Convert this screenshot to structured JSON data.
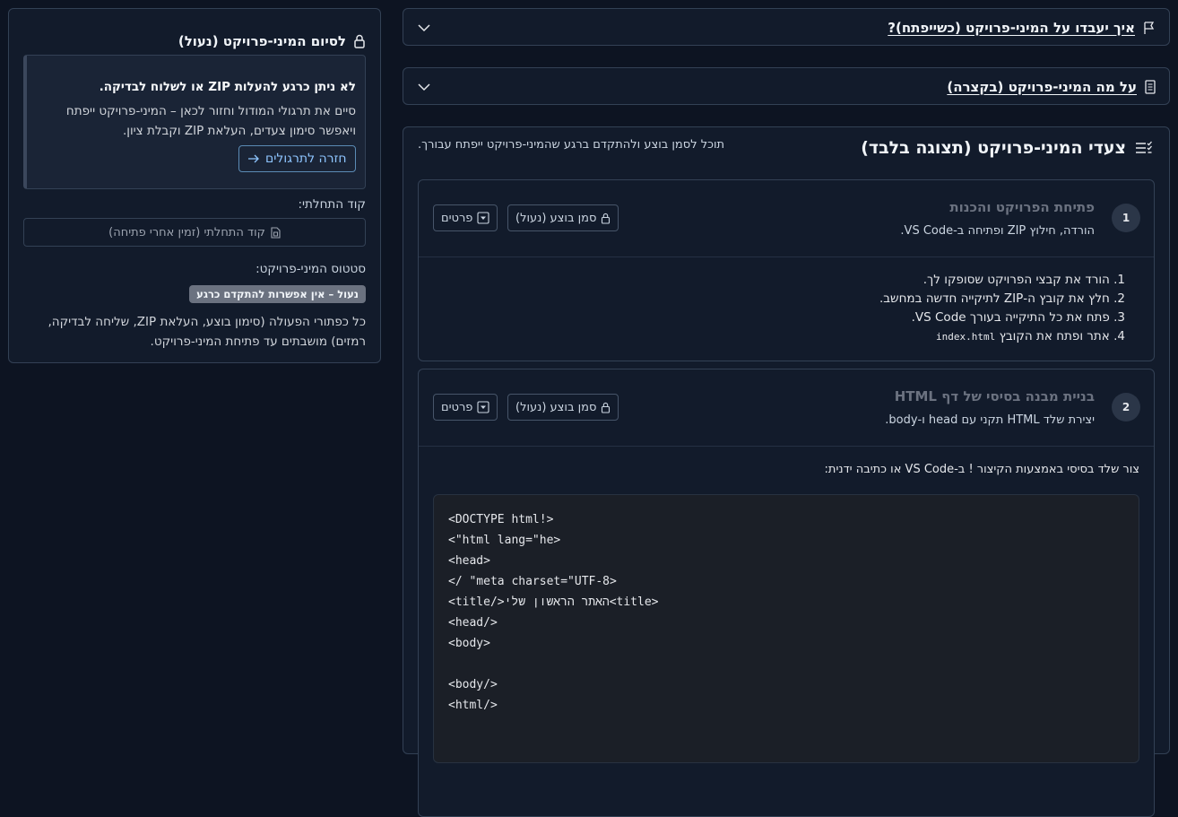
{
  "side": {
    "title": "לסיום המיני-פרויקט (נעול)",
    "warning_title": "לא ניתן כרגע להעלות ZIP או לשלוח לבדיקה.",
    "warning_body": "סיים את תרגולי המודול וחזור לכאן – המיני-פרויקט ייפתח ויאפשר סימון צעדים, העלאת ZIP וקבלת ציון.",
    "back_button": "חזרה לתרגולים",
    "code_label": "קוד התחלתי:",
    "code_button": "קוד התחלתי (זמין אחרי פתיחה)",
    "status_label": "סטטוס המיני-פרויקט:",
    "status_badge": "נעול – אין אפשרות להתקדם כרגע",
    "status_note": "כל כפתורי הפעולה (סימון בוצע, העלאת ZIP, שליחה לבדיקה, רמזים) מושבתים עד פתיחת המיני-פרויקט."
  },
  "accordions": [
    {
      "label": "איך יעבדו על המיני-פרויקט (כשייפתח)?",
      "icon": "flag-icon"
    },
    {
      "label": "על מה המיני-פרויקט (בקצרה)",
      "icon": "document-icon"
    }
  ],
  "main": {
    "title": "צעדי המיני-פרויקט (תצוגה בלבד)",
    "subtitle": "תוכל לסמן בוצע ולהתקדם ברגע שהמיני-פרויקט ייפתח עבורך.",
    "mark_done_label": "סמן בוצע (נעול)",
    "details_label": "פרטים",
    "steps": [
      {
        "num": "1",
        "title": "פתיחת הפרויקט והכנות",
        "subtitle": "הורדה, חילוץ ZIP ופתיחה ב-VS Code.",
        "items": [
          "1. הורד את קבצי הפרויקט שסופקו לך.",
          "2. חלץ את קובץ ה-ZIP לתיקייה חדשה במחשב.",
          "3. פתח את כל התיקייה בעורך VS Code.",
          "4. אתר ופתח את הקובץ"
        ],
        "code_file": "index.html"
      },
      {
        "num": "2",
        "title": "בניית מבנה בסיסי של דף HTML",
        "subtitle": "יצירת שלד HTML תקני עם head ו-body.",
        "intro": "צור שלד בסיסי באמצעות הקיצור ! ב-VS Code או כתיבה ידנית:",
        "code": "<DOCTYPE html!>\n<\"html lang=\"he>\n<head>\n</ \"meta charset=\"UTF-8>\n<title/>האתר הראשון שלי<title>\n<head/>\n<body>\n\n<body/>\n<html/>"
      }
    ]
  }
}
